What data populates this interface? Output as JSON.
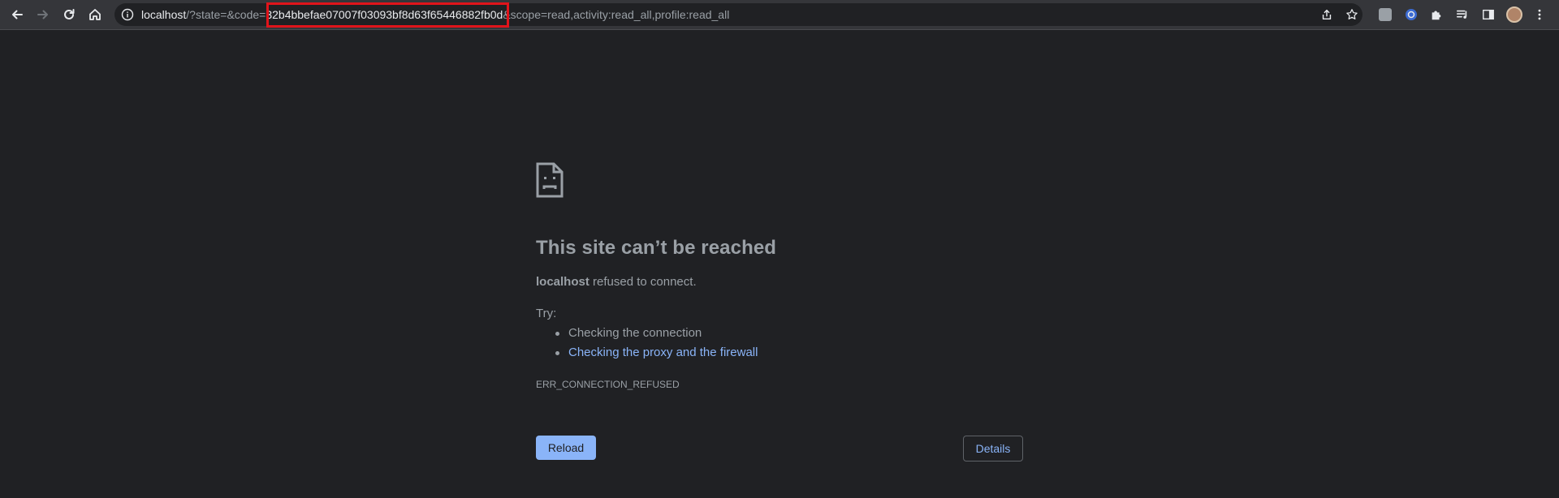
{
  "toolbar": {
    "url_host": "localhost",
    "url_prefix": "/?state=&code=",
    "url_code": "32b4bbefae07007f03093bf8d63f65446882fb0d",
    "url_suffix": "&scope=read,activity:read_all,profile:read_all",
    "back_icon": "arrow-left-icon",
    "forward_icon": "arrow-right-icon",
    "reload_icon": "reload-icon",
    "home_icon": "home-icon"
  },
  "error": {
    "title": "This site can’t be reached",
    "host": "localhost",
    "message": " refused to connect.",
    "try_label": "Try:",
    "suggestions": [
      "Checking the connection",
      "Checking the proxy and the firewall"
    ],
    "code": "ERR_CONNECTION_REFUSED",
    "reload_label": "Reload",
    "details_label": "Details"
  },
  "colors": {
    "background": "#202124",
    "toolbar": "#35363a",
    "text": "#9aa0a6",
    "link": "#8ab4f8",
    "highlight": "#e0141b"
  }
}
